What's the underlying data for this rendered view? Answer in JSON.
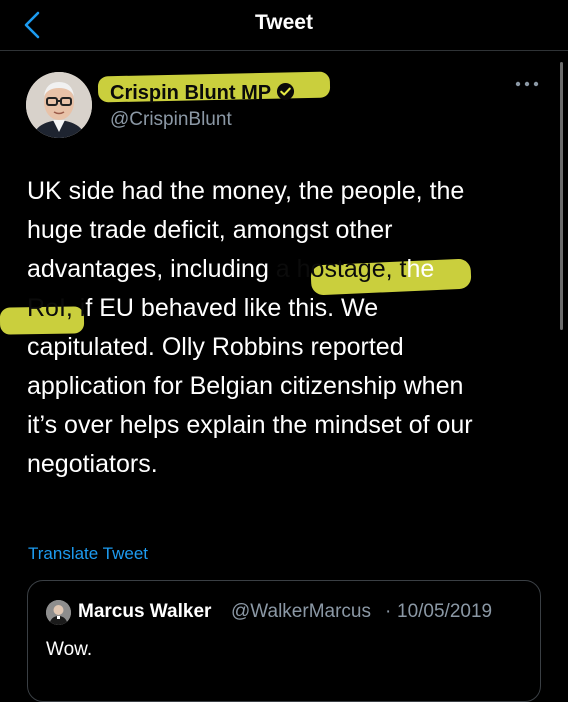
{
  "header": {
    "title": "Tweet",
    "back_icon": "chevron-left-icon",
    "accent": "#1d9bf0"
  },
  "tweet": {
    "author_name": "Crispin Blunt MP",
    "author_handle": "@CrispinBlunt",
    "verified_icon": "verified-badge-icon",
    "more_icon": "more-dots-icon",
    "highlight_color": "#e6ec45",
    "lines": [
      "UK side had the money, the people, the",
      "huge trade deficit, amongst other",
      "advantages, including a hostage, the",
      "RoI, if EU behaved like this. We",
      "capitulated. Olly Robbins reported",
      "application for Belgian citizenship when",
      "it’s over helps explain the mindset of our",
      "negotiators."
    ],
    "line3_parts": {
      "before": "advantages, including ",
      "highlighted": "a hostage, t",
      "after": "he"
    },
    "line4_parts": {
      "highlighted": "RoI, i",
      "after": "f EU behaved like this. We"
    },
    "translate_label": "Translate Tweet"
  },
  "quote": {
    "author_name": "Marcus Walker",
    "author_handle": "@WalkerMarcus",
    "separator": "·",
    "date": "10/05/2019",
    "text": "Wow."
  }
}
